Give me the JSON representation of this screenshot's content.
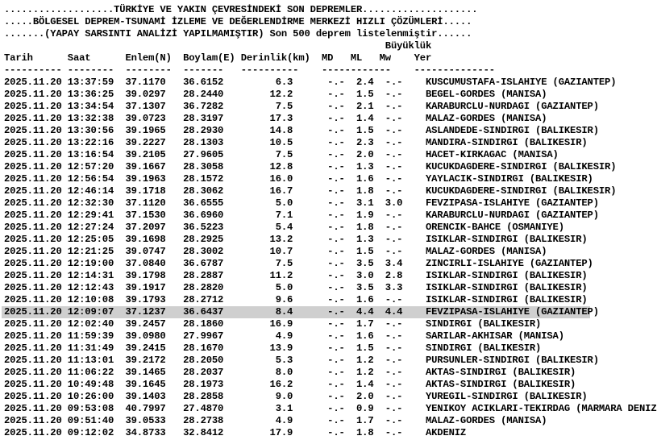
{
  "header": {
    "line1": "...................TÜRKİYE VE YAKIN ÇEVRESİNDEKİ SON DEPREMLER....................",
    "line2": ".....BÖLGESEL DEPREM-TSUNAMİ İZLEME VE DEĞERLENDİRME MERKEZİ HIZLI ÇÖZÜMLERİ.....",
    "line3": ".......(YAPAY SARSINTI ANALİZİ YAPILMAMIŞTIR) Son 500 deprem listelenmiştir......"
  },
  "columns": {
    "group_line": "                                                                  Büyüklük",
    "header_line": "Tarih      Saat      Enlem(N)  Boylam(E) Derinlik(km)  MD   ML   Mw    Yer",
    "separator_line": "---------- --------  --------  -------   ----------    ------------    --------------"
  },
  "rows": [
    {
      "date": "2025.11.20",
      "time": "13:37:59",
      "lat": "37.1170",
      "lon": "36.6152",
      "depth": "6.3",
      "md": "-.-",
      "ml": "2.4",
      "mw": "-.-",
      "place": "KUSCUMUSTAFA-ISLAHIYE (GAZIANTEP)"
    },
    {
      "date": "2025.11.20",
      "time": "13:36:25",
      "lat": "39.0297",
      "lon": "28.2440",
      "depth": "12.2",
      "md": "-.-",
      "ml": "1.5",
      "mw": "-.-",
      "place": "BEGEL-GORDES (MANISA)"
    },
    {
      "date": "2025.11.20",
      "time": "13:34:54",
      "lat": "37.1307",
      "lon": "36.7282",
      "depth": "7.5",
      "md": "-.-",
      "ml": "2.1",
      "mw": "-.-",
      "place": "KARABURCLU-NURDAGI (GAZIANTEP)"
    },
    {
      "date": "2025.11.20",
      "time": "13:32:38",
      "lat": "39.0723",
      "lon": "28.3197",
      "depth": "17.3",
      "md": "-.-",
      "ml": "1.4",
      "mw": "-.-",
      "place": "MALAZ-GORDES (MANISA)"
    },
    {
      "date": "2025.11.20",
      "time": "13:30:56",
      "lat": "39.1965",
      "lon": "28.2930",
      "depth": "14.8",
      "md": "-.-",
      "ml": "1.5",
      "mw": "-.-",
      "place": "ASLANDEDE-SINDIRGI (BALIKESIR)"
    },
    {
      "date": "2025.11.20",
      "time": "13:22:16",
      "lat": "39.2227",
      "lon": "28.1303",
      "depth": "10.5",
      "md": "-.-",
      "ml": "2.3",
      "mw": "-.-",
      "place": "MANDIRA-SINDIRGI (BALIKESIR)"
    },
    {
      "date": "2025.11.20",
      "time": "13:16:54",
      "lat": "39.2105",
      "lon": "27.9605",
      "depth": "7.5",
      "md": "-.-",
      "ml": "2.0",
      "mw": "-.-",
      "place": "HACET-KIRKAGAC (MANISA)"
    },
    {
      "date": "2025.11.20",
      "time": "12:57:20",
      "lat": "39.1667",
      "lon": "28.3058",
      "depth": "12.8",
      "md": "-.-",
      "ml": "1.3",
      "mw": "-.-",
      "place": "KUCUKDAGDERE-SINDIRGI (BALIKESIR)"
    },
    {
      "date": "2025.11.20",
      "time": "12:56:54",
      "lat": "39.1963",
      "lon": "28.1572",
      "depth": "16.0",
      "md": "-.-",
      "ml": "1.6",
      "mw": "-.-",
      "place": "YAYLACIK-SINDIRGI (BALIKESIR)"
    },
    {
      "date": "2025.11.20",
      "time": "12:46:14",
      "lat": "39.1718",
      "lon": "28.3062",
      "depth": "16.7",
      "md": "-.-",
      "ml": "1.8",
      "mw": "-.-",
      "place": "KUCUKDAGDERE-SINDIRGI (BALIKESIR)"
    },
    {
      "date": "2025.11.20",
      "time": "12:32:30",
      "lat": "37.1120",
      "lon": "36.6555",
      "depth": "5.0",
      "md": "-.-",
      "ml": "3.1",
      "mw": "3.0",
      "place": "FEVZIPASA-ISLAHIYE (GAZIANTEP)"
    },
    {
      "date": "2025.11.20",
      "time": "12:29:41",
      "lat": "37.1530",
      "lon": "36.6960",
      "depth": "7.1",
      "md": "-.-",
      "ml": "1.9",
      "mw": "-.-",
      "place": "KARABURCLU-NURDAGI (GAZIANTEP)"
    },
    {
      "date": "2025.11.20",
      "time": "12:27:24",
      "lat": "37.2097",
      "lon": "36.5223",
      "depth": "5.4",
      "md": "-.-",
      "ml": "1.8",
      "mw": "-.-",
      "place": "ORENCIK-BAHCE (OSMANIYE)"
    },
    {
      "date": "2025.11.20",
      "time": "12:25:05",
      "lat": "39.1698",
      "lon": "28.2925",
      "depth": "13.2",
      "md": "-.-",
      "ml": "1.3",
      "mw": "-.-",
      "place": "ISIKLAR-SINDIRGI (BALIKESIR)"
    },
    {
      "date": "2025.11.20",
      "time": "12:21:25",
      "lat": "39.0747",
      "lon": "28.3002",
      "depth": "10.7",
      "md": "-.-",
      "ml": "1.5",
      "mw": "-.-",
      "place": "MALAZ-GORDES (MANISA)"
    },
    {
      "date": "2025.11.20",
      "time": "12:19:00",
      "lat": "37.0840",
      "lon": "36.6787",
      "depth": "7.5",
      "md": "-.-",
      "ml": "3.5",
      "mw": "3.4",
      "place": "ZINCIRLI-ISLAHIYE (GAZIANTEP)"
    },
    {
      "date": "2025.11.20",
      "time": "12:14:31",
      "lat": "39.1798",
      "lon": "28.2887",
      "depth": "11.2",
      "md": "-.-",
      "ml": "3.0",
      "mw": "2.8",
      "place": "ISIKLAR-SINDIRGI (BALIKESIR)"
    },
    {
      "date": "2025.11.20",
      "time": "12:12:43",
      "lat": "39.1917",
      "lon": "28.2820",
      "depth": "5.0",
      "md": "-.-",
      "ml": "3.5",
      "mw": "3.3",
      "place": "ISIKLAR-SINDIRGI (BALIKESIR)"
    },
    {
      "date": "2025.11.20",
      "time": "12:10:08",
      "lat": "39.1793",
      "lon": "28.2712",
      "depth": "9.6",
      "md": "-.-",
      "ml": "1.6",
      "mw": "-.-",
      "place": "ISIKLAR-SINDIRGI (BALIKESIR)"
    },
    {
      "date": "2025.11.20",
      "time": "12:09:07",
      "lat": "37.1237",
      "lon": "36.6437",
      "depth": "8.4",
      "md": "-.-",
      "ml": "4.4",
      "mw": "4.4",
      "place": "FEVZIPASA-ISLAHIYE (GAZIANTEP)",
      "highlighted": true
    },
    {
      "date": "2025.11.20",
      "time": "12:02:40",
      "lat": "39.2457",
      "lon": "28.1860",
      "depth": "16.9",
      "md": "-.-",
      "ml": "1.7",
      "mw": "-.-",
      "place": "SINDIRGI (BALIKESIR)"
    },
    {
      "date": "2025.11.20",
      "time": "11:59:39",
      "lat": "39.0980",
      "lon": "27.9967",
      "depth": "4.9",
      "md": "-.-",
      "ml": "1.6",
      "mw": "-.-",
      "place": "SARILAR-AKHISAR (MANISA)"
    },
    {
      "date": "2025.11.20",
      "time": "11:31:49",
      "lat": "39.2415",
      "lon": "28.1670",
      "depth": "13.9",
      "md": "-.-",
      "ml": "1.5",
      "mw": "-.-",
      "place": "SINDIRGI (BALIKESIR)"
    },
    {
      "date": "2025.11.20",
      "time": "11:13:01",
      "lat": "39.2172",
      "lon": "28.2050",
      "depth": "5.3",
      "md": "-.-",
      "ml": "1.2",
      "mw": "-.-",
      "place": "PURSUNLER-SINDIRGI (BALIKESIR)"
    },
    {
      "date": "2025.11.20",
      "time": "11:06:22",
      "lat": "39.1465",
      "lon": "28.2037",
      "depth": "8.0",
      "md": "-.-",
      "ml": "1.2",
      "mw": "-.-",
      "place": "AKTAS-SINDIRGI (BALIKESIR)"
    },
    {
      "date": "2025.11.20",
      "time": "10:49:48",
      "lat": "39.1645",
      "lon": "28.1973",
      "depth": "16.2",
      "md": "-.-",
      "ml": "1.4",
      "mw": "-.-",
      "place": "AKTAS-SINDIRGI (BALIKESIR)"
    },
    {
      "date": "2025.11.20",
      "time": "10:26:00",
      "lat": "39.1403",
      "lon": "28.2858",
      "depth": "9.0",
      "md": "-.-",
      "ml": "2.0",
      "mw": "-.-",
      "place": "YUREGIL-SINDIRGI (BALIKESIR)"
    },
    {
      "date": "2025.11.20",
      "time": "09:53:08",
      "lat": "40.7997",
      "lon": "27.4870",
      "depth": "3.1",
      "md": "-.-",
      "ml": "0.9",
      "mw": "-.-",
      "place": "YENIKOY ACIKLARI-TEKIRDAG (MARMARA DENIZI)"
    },
    {
      "date": "2025.11.20",
      "time": "09:51:40",
      "lat": "39.0533",
      "lon": "28.2738",
      "depth": "4.9",
      "md": "-.-",
      "ml": "1.7",
      "mw": "-.-",
      "place": "MALAZ-GORDES (MANISA)"
    },
    {
      "date": "2025.11.20",
      "time": "09:12:02",
      "lat": "34.8733",
      "lon": "32.8412",
      "depth": "17.9",
      "md": "-.-",
      "ml": "1.8",
      "mw": "-.-",
      "place": "AKDENIZ"
    }
  ]
}
